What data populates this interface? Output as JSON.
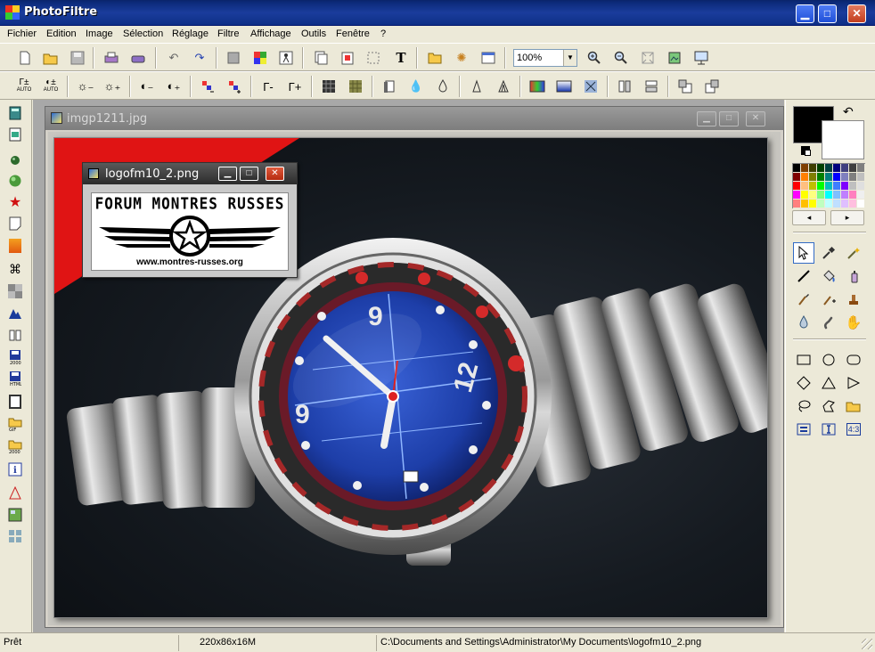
{
  "app": {
    "title": "PhotoFiltre"
  },
  "window_buttons": {
    "minimize": "▁",
    "maximize": "□",
    "close": "✕"
  },
  "menu": [
    "Fichier",
    "Edition",
    "Image",
    "Sélection",
    "Réglage",
    "Filtre",
    "Affichage",
    "Outils",
    "Fenêtre",
    "?"
  ],
  "toolbar1": {
    "zoom_value": "100%",
    "zoom_dropdown": "▼",
    "buttons": [
      "new-icon",
      "open-icon",
      "save-icon",
      "print-icon",
      "scan-icon",
      "undo-icon",
      "redo-icon",
      "fill-icon",
      "grid-icon",
      "run-icon",
      "copy-icon",
      "paste-icon",
      "select-icon",
      "text-icon",
      "browser-icon",
      "plugin-icon",
      "window-icon",
      "zoom-in-icon",
      "zoom-out-icon",
      "actual-size-icon",
      "fit-icon",
      "fullscreen-icon"
    ],
    "glyphs": {
      "text": "T"
    }
  },
  "toolbar2": {
    "labels": {
      "auto_levels": "AUTO",
      "auto_contrast": "AUTO",
      "gamma_minus": "Γ-",
      "gamma_plus": "Γ+",
      "gamma_auto": "Γ±",
      "contrast_auto": "◐±"
    },
    "buttons": [
      "auto-levels-icon",
      "auto-contrast-icon",
      "brightness-minus-icon",
      "brightness-plus-icon",
      "contrast-minus-icon",
      "contrast-plus-icon",
      "saturation-minus-icon",
      "saturation-plus-icon",
      "gamma-minus-icon",
      "gamma-plus-icon",
      "mosaic-icon",
      "texture-icon",
      "shadow-icon",
      "drop-icon",
      "blur-icon",
      "sharpen-icon",
      "sharpen-more-icon",
      "gradient-icon",
      "gradient-dark-icon",
      "artistic-icon",
      "flip-horizontal-icon",
      "flip-vertical-icon",
      "rotate-left-icon",
      "rotate-right-icon"
    ]
  },
  "leftbar": [
    "calculator-icon",
    "film-icon",
    "bomb-icon",
    "sphere-icon",
    "star-icon",
    "note-icon",
    "gradient-bar-icon",
    "network-icon",
    "checker-icon",
    "mountain-icon",
    "book-icon",
    "save-2000-icon",
    "save-html-icon",
    "frame-icon",
    "open-gif-icon",
    "open-2000-icon",
    "info-icon",
    "alert-icon",
    "images-icon",
    "tiles-icon"
  ],
  "image_window": {
    "title": "imgp1211.jpg"
  },
  "logo_window": {
    "title": "logofm10_2.png",
    "logo_text": "FORUM MONTRES RUSSES",
    "logo_url": "www.montres-russes.org"
  },
  "right_panel": {
    "swap_icon": "↶",
    "palette": [
      "#000000",
      "#7f3f00",
      "#3f3f00",
      "#003f00",
      "#003f3f",
      "#00007f",
      "#3f3f7f",
      "#3f3f3f",
      "#7f7f7f",
      "#7f0000",
      "#ff7f00",
      "#7f7f00",
      "#007f00",
      "#007f7f",
      "#0000ff",
      "#7f7fbf",
      "#7f7f7f",
      "#bfbfbf",
      "#ff0000",
      "#ffbf7f",
      "#bfbf00",
      "#00ff00",
      "#00bfbf",
      "#3f7fff",
      "#7f00ff",
      "#bfbfbf",
      "#dfdfdf",
      "#ff00ff",
      "#ffff00",
      "#ffff7f",
      "#7fff7f",
      "#00ffff",
      "#7fbfff",
      "#bf7fff",
      "#ff7fbf",
      "#efefef",
      "#ff7f7f",
      "#ffbf00",
      "#ffff00",
      "#bfffbf",
      "#bfffff",
      "#bfdfff",
      "#dfbfff",
      "#ffbfdf",
      "#ffffff"
    ],
    "prev_label": "◂",
    "next_label": "▸",
    "tools": [
      "pointer-icon",
      "eyedropper-icon",
      "magic-wand-icon",
      "line-icon",
      "paint-bucket-icon",
      "spray-icon",
      "brush-icon",
      "advanced-brush-icon",
      "stamp-icon",
      "blur-drop-icon",
      "finger-icon",
      "hand-icon"
    ],
    "shapes": [
      "rectangle-icon",
      "ellipse-icon",
      "rounded-rect-icon",
      "diamond-icon",
      "triangle-icon",
      "triangle-right-icon",
      "lasso-icon",
      "polygon-icon",
      "open-shape-icon",
      "select-all-icon",
      "text-select-icon",
      "ratio-icon"
    ],
    "ratio_label": "4:3"
  },
  "status": {
    "ready": "Prêt",
    "size": "220x86x16M",
    "path": "C:\\Documents and Settings\\Administrator\\My Documents\\logofm10_2.png"
  },
  "colors": {
    "titlebar": "#0c2a7a",
    "workspace": "#a8a8a8",
    "foreground": "#000000",
    "background": "#ffffff",
    "watch_dial": "#1d3ea8",
    "corner_red": "#e01414"
  }
}
